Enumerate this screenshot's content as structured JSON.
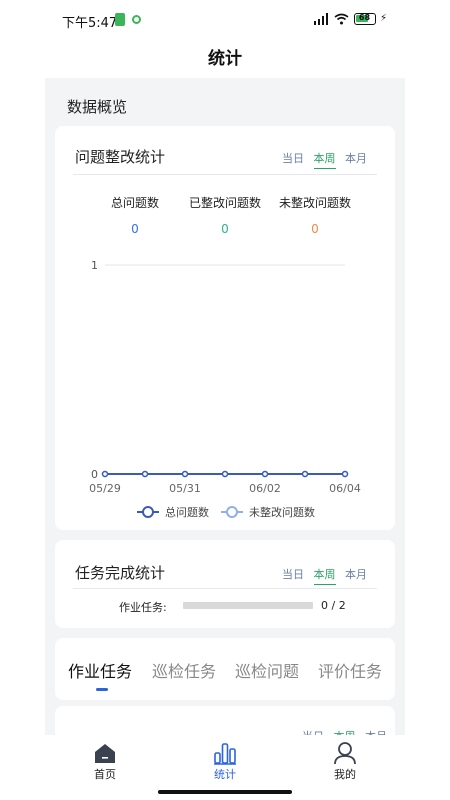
{
  "status_bar": {
    "time": "下午5:47",
    "battery": "68",
    "colors": {
      "battery_fill": "#3cb55a"
    }
  },
  "page_title": "统计",
  "overview_title": "数据概览",
  "problem_card": {
    "title": "问题整改统计",
    "period_tabs": [
      {
        "label": "当日",
        "active": false
      },
      {
        "label": "本周",
        "active": true
      },
      {
        "label": "本月",
        "active": false
      }
    ],
    "stats": [
      {
        "label": "总问题数",
        "value": "0",
        "color": "#3b6ee0"
      },
      {
        "label": "已整改问题数",
        "value": "0",
        "color": "#2bb38f"
      },
      {
        "label": "未整改问题数",
        "value": "0",
        "color": "#f0894a"
      }
    ]
  },
  "chart_data": {
    "type": "line",
    "x": [
      "05/29",
      "05/30",
      "05/31",
      "06/01",
      "06/02",
      "06/03",
      "06/04"
    ],
    "x_tick_labels": [
      "05/29",
      "05/31",
      "06/02",
      "06/04"
    ],
    "y_ticks": [
      "0",
      "1"
    ],
    "ylim": [
      0,
      1
    ],
    "grid": true,
    "legend_position": "bottom",
    "series": [
      {
        "name": "总问题数",
        "values": [
          0,
          0,
          0,
          0,
          0,
          0,
          0
        ],
        "color": "#3b5bb5"
      },
      {
        "name": "未整改问题数",
        "values": [
          0,
          0,
          0,
          0,
          0,
          0,
          0
        ],
        "color": "#8fb0ea"
      }
    ]
  },
  "task_card": {
    "title": "任务完成统计",
    "period_tabs": [
      {
        "label": "当日",
        "active": false
      },
      {
        "label": "本周",
        "active": true
      },
      {
        "label": "本月",
        "active": false
      }
    ],
    "label": "作业任务:",
    "progress": 0,
    "count": "0 / 2"
  },
  "task_tabs": [
    {
      "label": "作业任务",
      "active": true
    },
    {
      "label": "巡检任务",
      "active": false
    },
    {
      "label": "巡检问题",
      "active": false
    },
    {
      "label": "评价任务",
      "active": false
    }
  ],
  "bottom_card": {
    "period_tabs": [
      {
        "label": "当日",
        "active": false
      },
      {
        "label": "本周",
        "active": true
      },
      {
        "label": "本月",
        "active": false
      }
    ]
  },
  "bottom_nav": [
    {
      "label": "首页",
      "icon": "home-icon",
      "active": false
    },
    {
      "label": "统计",
      "icon": "bar-chart-icon",
      "active": true
    },
    {
      "label": "我的",
      "icon": "user-icon",
      "active": false
    }
  ],
  "colors": {
    "accent": "#2b63e0",
    "tab_active": "#2ba364",
    "tab_inactive": "#6b7fa8"
  }
}
